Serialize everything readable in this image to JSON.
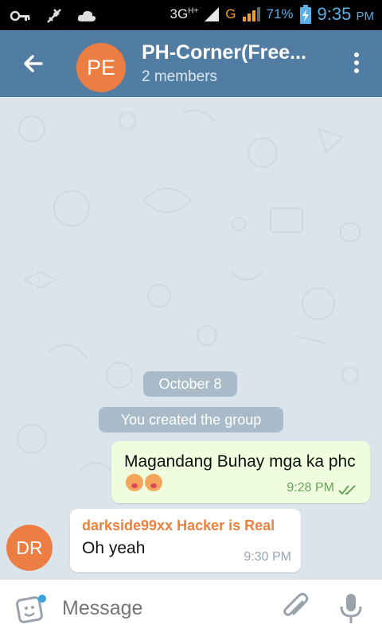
{
  "status_bar": {
    "network": "3G",
    "network_sup": "H+",
    "carrier_g": "G",
    "battery": "71%",
    "time": "9:35",
    "ampm": "PM"
  },
  "header": {
    "avatar_initials": "PE",
    "title": "PH-Corner(Free...",
    "subtitle": "2 members"
  },
  "chat": {
    "date_chip": "October 8",
    "service_message": "You created the group",
    "messages": [
      {
        "direction": "out",
        "text": "Magandang Buhay mga ka phc",
        "time": "9:28 PM",
        "status": "read"
      },
      {
        "direction": "in",
        "avatar_initials": "DR",
        "sender": "darkside99xx Hacker is Real",
        "text": "Oh yeah",
        "time": "9:30 PM"
      }
    ]
  },
  "composer": {
    "placeholder": "Message"
  },
  "colors": {
    "header": "#527da3",
    "avatar": "#ec7d43",
    "out_bubble": "#effdde",
    "sender_name": "#e9823e",
    "chip": "#a9bac8"
  }
}
